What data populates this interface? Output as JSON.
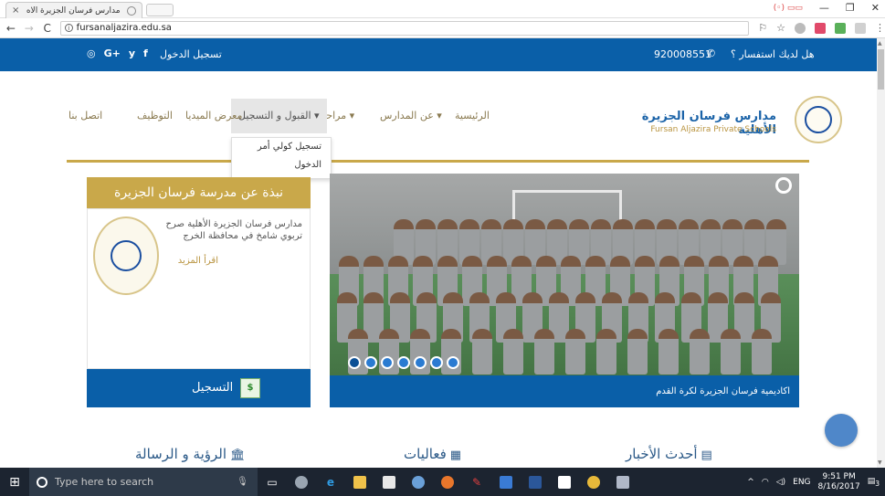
{
  "browser": {
    "tab_title": "مدارس فرسان الجزيرة الاه",
    "tab_close": "×",
    "url": "fursanaljazira.edu.sa",
    "window_controls": [
      "—",
      "❐",
      "✕"
    ],
    "badge": "(◦) ▭▭"
  },
  "site": {
    "top_bar": {
      "login": "تسجيل الدخول",
      "socials": [
        "◎",
        "G+",
        "🐦",
        "f"
      ],
      "phone": "920008551",
      "inquiry": "هل لديك استفسار ؟"
    },
    "brand": {
      "name_ar": "مدارس فرسان الجزيرة الأهلية",
      "name_en": "Fursan Aljazira Private Schools"
    },
    "menu": {
      "home": "الرئيسية",
      "schools": "عن المدارس ▾",
      "stages": "مراحلنا ▾",
      "admission": "القبول و التسجيل ▾",
      "media": "معرض الميديا",
      "jobs": "التوظيف",
      "contact": "اتصل بنا"
    },
    "dropdown": {
      "register_guardian": "تسجيل كولي أمر",
      "login": "الدخول"
    },
    "about": {
      "title": "نبذة عن مدرسة فرسان الجزيرة",
      "text": "مدارس فرسان الجزيرة الأهلية صرح تربوي شامخ في محافظة الخرج",
      "more": "اقرأ المزيد"
    },
    "register": {
      "label": "التسجيل",
      "icon_text": "$"
    },
    "slider": {
      "caption": "اكاديمية فرسان الجزيرة لكرة القدم",
      "dot_count": 7
    },
    "sections": {
      "vision": "الرؤية و الرسالة",
      "events": "فعاليات",
      "news": "أحدث الأخبار"
    }
  },
  "taskbar": {
    "search_placeholder": "Type here to search",
    "tray_lang": "ENG",
    "time": "9:51 PM",
    "date": "8/16/2017",
    "notif_count": "3"
  },
  "colors": {
    "brand_blue": "#0a5fa8",
    "gold": "#c9a84a",
    "taskbar": "#1c2430"
  }
}
